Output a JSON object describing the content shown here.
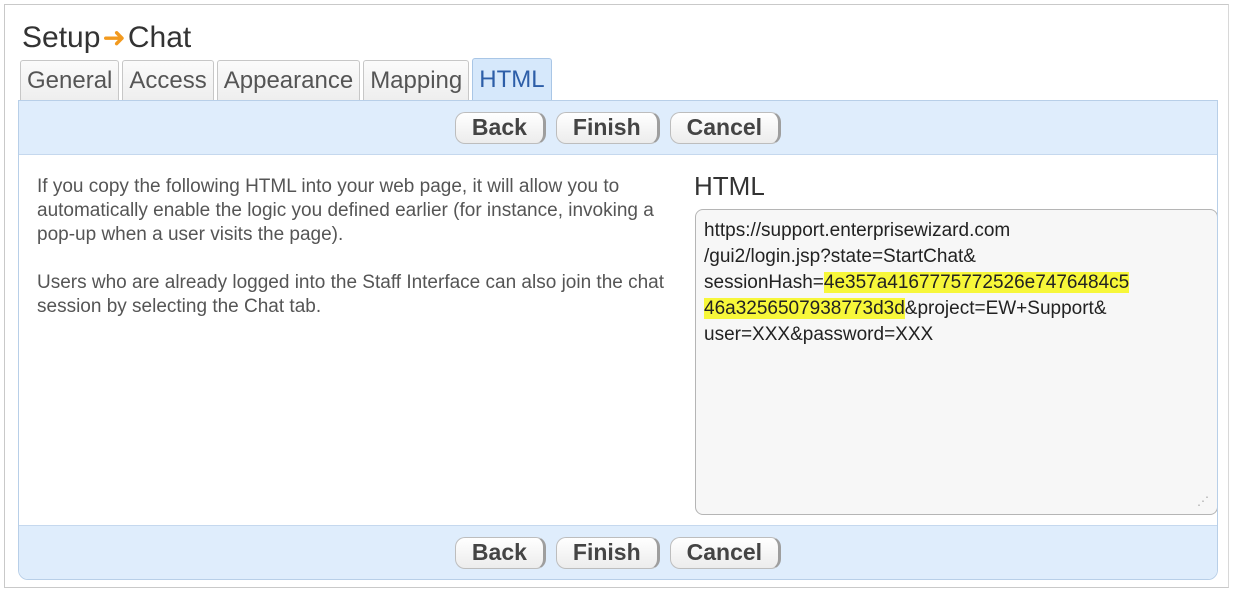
{
  "breadcrumb": {
    "parent": "Setup",
    "current": "Chat"
  },
  "tabs": [
    {
      "label": "General",
      "active": false
    },
    {
      "label": "Access",
      "active": false
    },
    {
      "label": "Appearance",
      "active": false
    },
    {
      "label": "Mapping",
      "active": false
    },
    {
      "label": "HTML",
      "active": true
    }
  ],
  "buttons": {
    "back": "Back",
    "finish": "Finish",
    "cancel": "Cancel"
  },
  "description": {
    "paragraph1": "If you copy the following HTML into your web page, it will allow you to automatically enable the logic you defined earlier (for instance, invoking a pop-up when a user visits the page).",
    "paragraph2": "Users who are already logged into the Staff Interface can also join the chat session by selecting the Chat tab."
  },
  "html_section": {
    "heading": "HTML",
    "line1": "https://support.enterprisewizard.com",
    "line2": "/gui2/login.jsp?state=StartChat&",
    "line3_prefix": "sessionHash=",
    "line3_highlight": "4e357a4167775772526e7476484c5",
    "line4_highlight": "46a3256507938773d3d",
    "line4_suffix": "&project=EW+Support&",
    "line5": "user=XXX&password=XXX"
  },
  "colors": {
    "accent_arrow": "#f29a1f",
    "button_bar": "#dfedfc",
    "active_tab": "#d6e8fb",
    "highlight": "#f7f73a"
  }
}
